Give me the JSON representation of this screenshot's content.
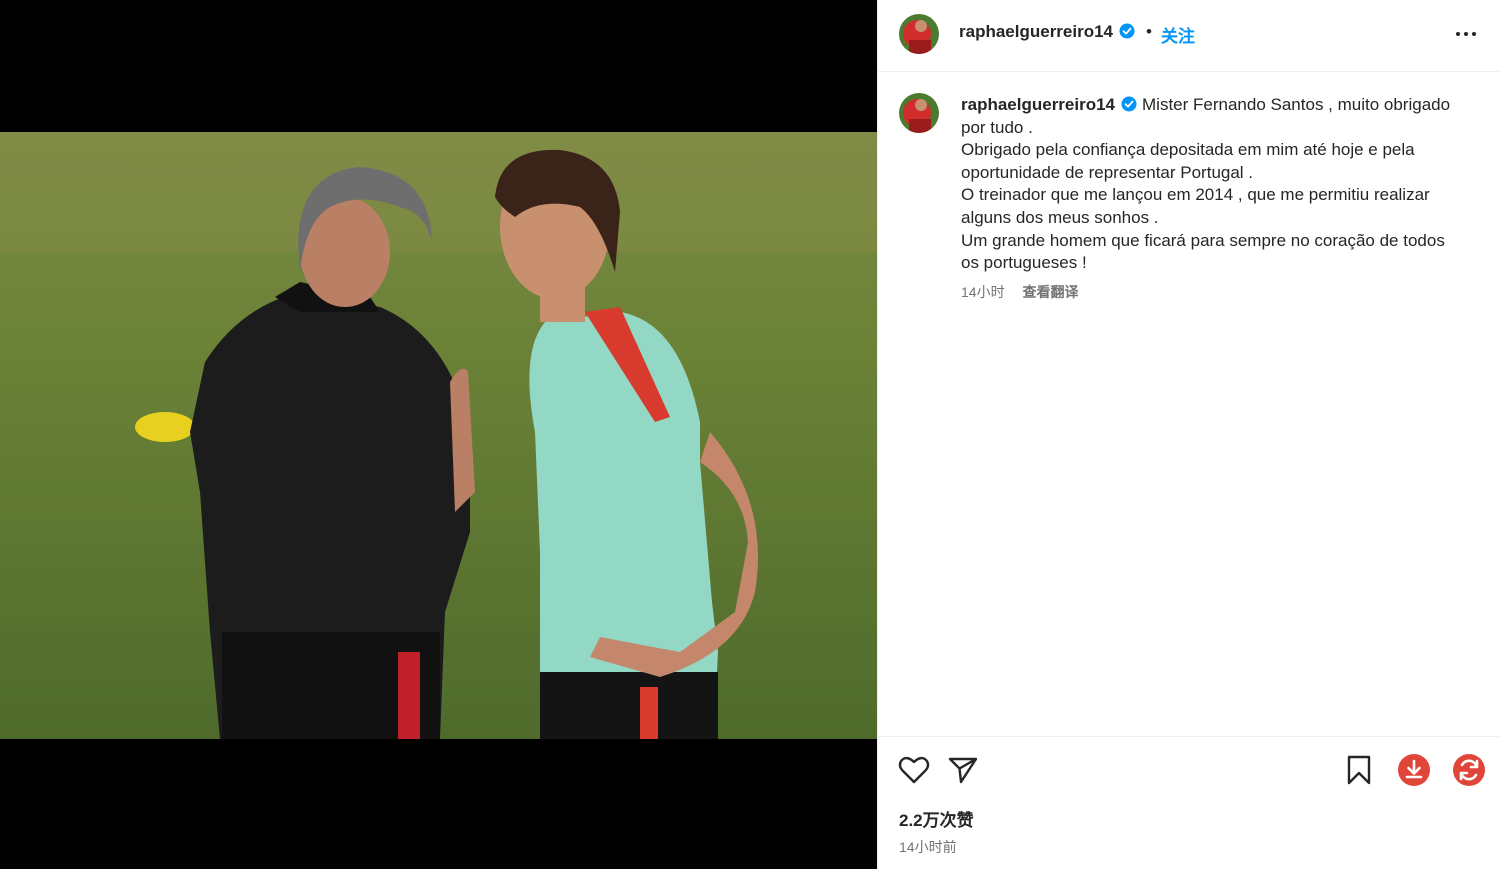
{
  "post": {
    "username": "raphaelguerreiro14",
    "follow_label": "关注",
    "separator": "•"
  },
  "caption": {
    "lines": [
      "Mister Fernando Santos , muito obrigado",
      "por tudo .",
      "Obrigado pela confiança depositada em mim até hoje e pela",
      "oportunidade de representar Portugal .",
      "O treinador que me lançou em 2014 , que me permitiu realizar",
      "alguns dos meus sonhos .",
      "Um grande homem que ficará para sempre no coração de todos",
      "os portugueses !"
    ],
    "time": "14小时",
    "translate_label": "查看翻译"
  },
  "stats": {
    "likes": "2.2万次赞",
    "posted": "14小时前"
  },
  "colors": {
    "accent": "#0095f6",
    "download_button": "#e0453a",
    "sync_button": "#e0453a",
    "jersey": "#8fd6c0",
    "grass": "#5f7a33"
  },
  "icons": [
    "heart-icon",
    "share-icon",
    "bookmark-icon",
    "download-icon",
    "refresh-icon",
    "verified-icon",
    "more-icon"
  ]
}
